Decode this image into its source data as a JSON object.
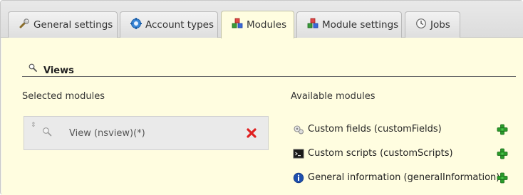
{
  "tabs": [
    {
      "label": "General settings",
      "icon": "wrench-icon",
      "active": false
    },
    {
      "label": "Account types",
      "icon": "gear-icon",
      "active": false
    },
    {
      "label": "Modules",
      "icon": "modules-icon",
      "active": true
    },
    {
      "label": "Module settings",
      "icon": "modules-icon",
      "active": false
    },
    {
      "label": "Jobs",
      "icon": "clock-icon",
      "active": false
    }
  ],
  "section": {
    "title": "Views",
    "icon": "search-icon"
  },
  "selected": {
    "label": "Selected modules",
    "items": [
      {
        "name": "View (nsview)(*)",
        "icon": "search-icon",
        "remove_icon": "remove-icon"
      }
    ]
  },
  "available": {
    "label": "Available modules",
    "items": [
      {
        "name": "Custom fields (customFields)",
        "icon": "custom-fields-icon",
        "add_icon": "add-icon"
      },
      {
        "name": "Custom scripts (customScripts)",
        "icon": "terminal-icon",
        "add_icon": "add-icon"
      },
      {
        "name": "General information (generalInformation)",
        "icon": "info-icon",
        "add_icon": "add-icon"
      }
    ]
  },
  "colors": {
    "content_background": "#fffde0",
    "tab_bar": "#dcdcdc",
    "remove_red": "#e02020",
    "add_green": "#2a9b2a"
  }
}
